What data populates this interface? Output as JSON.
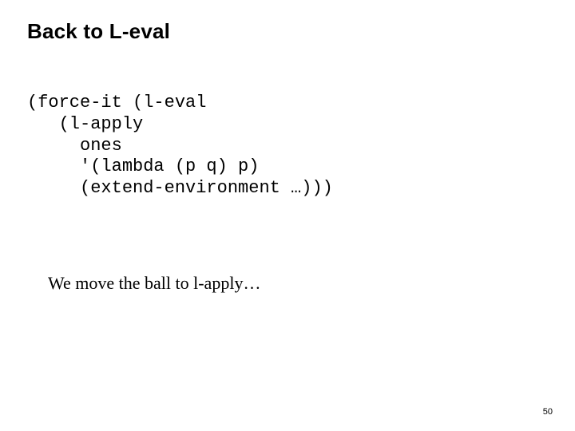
{
  "title": "Back to L-eval",
  "code": {
    "l1": "(force-it (l-eval",
    "l2": "   (l-apply",
    "l3": "     ones",
    "l4": "     '(lambda (p q) p)",
    "l5": "     (extend-environment …)))"
  },
  "body": "We move the ball to l-apply…",
  "page_number": "50"
}
